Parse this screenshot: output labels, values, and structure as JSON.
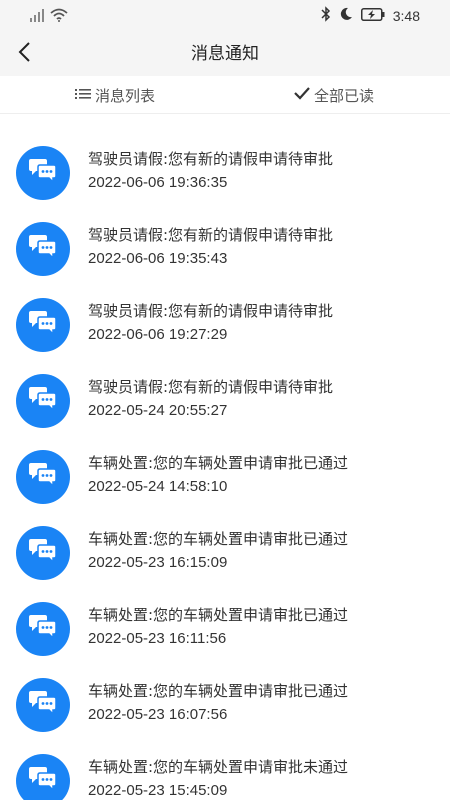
{
  "status_bar": {
    "time": "3:48",
    "signal_icon": "signal-icon",
    "wifi_icon": "wifi-icon",
    "bluetooth_icon": "bluetooth-icon",
    "moon_icon": "moon-icon",
    "battery_icon": "battery-icon"
  },
  "header": {
    "title": "消息通知",
    "back_icon": "back-arrow-icon"
  },
  "toolbar": {
    "list_label": "消息列表",
    "mark_all_label": "全部已读"
  },
  "colors": {
    "accent": "#1a84f5",
    "header_bg": "#f5f5f5",
    "text": "#333333"
  },
  "messages": [
    {
      "title": "驾驶员请假:您有新的请假申请待审批",
      "time": "2022-06-06 19:36:35"
    },
    {
      "title": "驾驶员请假:您有新的请假申请待审批",
      "time": "2022-06-06 19:35:43"
    },
    {
      "title": "驾驶员请假:您有新的请假申请待审批",
      "time": "2022-06-06 19:27:29"
    },
    {
      "title": "驾驶员请假:您有新的请假申请待审批",
      "time": "2022-05-24 20:55:27"
    },
    {
      "title": "车辆处置:您的车辆处置申请审批已通过",
      "time": "2022-05-24 14:58:10"
    },
    {
      "title": "车辆处置:您的车辆处置申请审批已通过",
      "time": "2022-05-23 16:15:09"
    },
    {
      "title": "车辆处置:您的车辆处置申请审批已通过",
      "time": "2022-05-23 16:11:56"
    },
    {
      "title": "车辆处置:您的车辆处置申请审批已通过",
      "time": "2022-05-23 16:07:56"
    },
    {
      "title": "车辆处置:您的车辆处置申请审批未通过",
      "time": "2022-05-23 15:45:09"
    }
  ]
}
